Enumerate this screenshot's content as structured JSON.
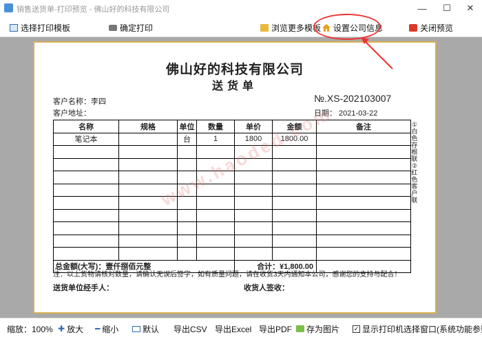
{
  "window": {
    "title": "销售送货单-打印预览 - 佛山好的科技有限公司",
    "controls": {
      "minimize": "—",
      "maximize": "☐",
      "close": "✕"
    }
  },
  "toolbar": {
    "select_template": "选择打印模板",
    "confirm_print": "确定打印",
    "browse_templates": "浏览更多模板",
    "company_settings": "设置公司信息",
    "close_preview": "关闭预览"
  },
  "document": {
    "company": "佛山好的科技有限公司",
    "title": "送货单",
    "customer_name_label": "客户名称：李四",
    "customer_address_label": "客户地址：",
    "number": "№.XS-202103007",
    "date": "日期： 2021-03-22",
    "columns": [
      "名称",
      "规格",
      "单位",
      "数量",
      "单价",
      "金额",
      "备注"
    ],
    "rows": [
      [
        "笔记本",
        "",
        "台",
        "1",
        "1800",
        "1800.00",
        ""
      ],
      [
        "",
        "",
        "",
        "",
        "",
        "",
        ""
      ],
      [
        "",
        "",
        "",
        "",
        "",
        "",
        ""
      ],
      [
        "",
        "",
        "",
        "",
        "",
        "",
        ""
      ],
      [
        "",
        "",
        "",
        "",
        "",
        "",
        ""
      ],
      [
        "",
        "",
        "",
        "",
        "",
        "",
        ""
      ],
      [
        "",
        "",
        "",
        "",
        "",
        "",
        ""
      ],
      [
        "",
        "",
        "",
        "",
        "",
        "",
        ""
      ],
      [
        "",
        "",
        "",
        "",
        "",
        "",
        ""
      ],
      [
        "",
        "",
        "",
        "",
        "",
        "",
        ""
      ]
    ],
    "total_words": "总金额(大写)：壹仟捌佰元整",
    "total_sum": "合计：¥1,800.00",
    "note": "注：以上货物请核对数量，请确认无误后签字，如有质量问题，请在收货3天内通知本公司，感谢您的支持与配合！",
    "deliverer_label": "送货单位经手人：",
    "receiver_label": "收货人签收：",
    "side_note": "①白色存根联 ②红色客户联",
    "watermark": "www.haoded.com"
  },
  "statusbar": {
    "zoom": "缩放：100%",
    "zoom_in": "放大",
    "zoom_out": "缩小",
    "default": "默认",
    "export_csv": "导出CSV",
    "export_excel": "导出Excel",
    "export_pdf": "导出PDF",
    "save_image": "存为图片",
    "show_printer_window": "显示打印机选择窗口(系统功能参数)"
  },
  "colors": {
    "page_border": "#d8b050",
    "canvas": "#a9a9a9",
    "annotation": "#e33333"
  }
}
